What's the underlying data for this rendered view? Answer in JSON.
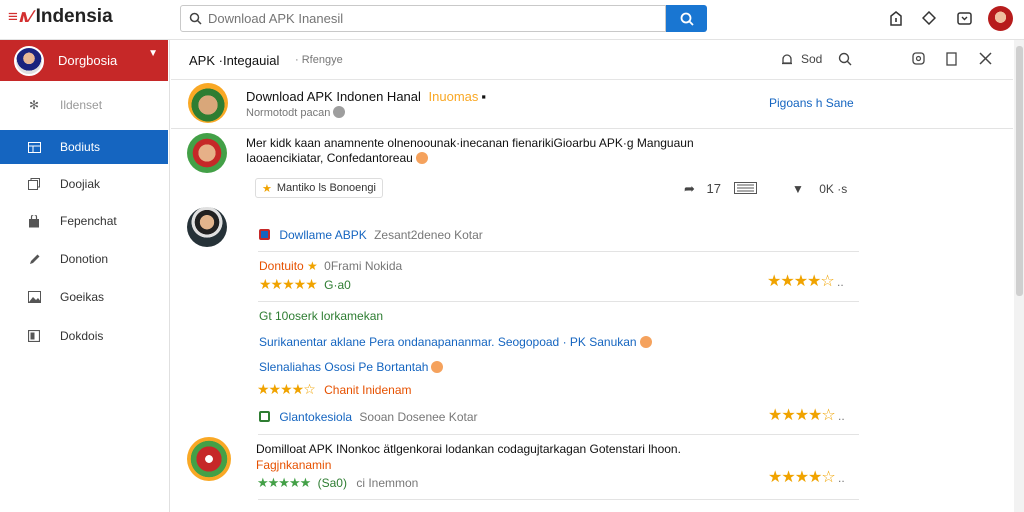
{
  "header": {
    "logo_mark": "≡∧∕",
    "logo_text": "Indensia",
    "search_placeholder": "Download APK Inanesil",
    "icons": [
      "search-icon",
      "info-icon",
      "tag-icon",
      "bookmark-icon",
      "avatar"
    ]
  },
  "sidebar": {
    "user_label": "Dorgbosia",
    "items": [
      {
        "label": "Ildenset",
        "icon": "gear-icon",
        "state": "muted"
      },
      {
        "label": "Bodiuts",
        "icon": "grid-icon",
        "state": "active"
      },
      {
        "label": "Doojiak",
        "icon": "copy-icon",
        "state": "normal"
      },
      {
        "label": "Fepenchat",
        "icon": "bag-icon",
        "state": "normal"
      },
      {
        "label": "Donotion",
        "icon": "pen-icon",
        "state": "normal"
      },
      {
        "label": "Goeikas",
        "icon": "image-icon",
        "state": "normal"
      },
      {
        "label": "Dokdois",
        "icon": "window-icon",
        "state": "normal"
      }
    ]
  },
  "tabbar": {
    "title": "APK ·Integauial",
    "subtitle": "· Rfengye",
    "action_label": "Sod"
  },
  "posts": {
    "p1": {
      "title": "Download APK Indonen Hanal",
      "title_tag": "Inuomas",
      "subtitle": "Normotodt pacan",
      "action": "Pigoans h Sane"
    },
    "p2": {
      "text_line1": "Mer kidk kaan anamnente olnenoounak·inecanan fienarikiGioarbu APK·g Manguaun",
      "text_line2": "Iaoaencikiatar, Confedantoreau",
      "chip": "Mantiko ls Bonoengi",
      "share_count": "17",
      "like_count": "0K ·s"
    },
    "p3": {
      "line1_link": "Dowllame ABPK",
      "line1_rest": "Zesant2deneo Kotar",
      "line2_name": "Dontuito",
      "line2_rest": "0Frami Nokida",
      "line3_score": "G·a0",
      "line4": "Gt 10oserk lorkamekan",
      "line5": "Surikanentar aklane Pera ondanapananmar. Seogopoad · PK Sanukan",
      "line6": "Slenaliahas Ososi Pe Bortantah",
      "line7_rest": "Chanit  Inidenam",
      "line8_link": "Glantokesiola",
      "line8_rest": "Sooan Dosenee Kotar"
    },
    "p4": {
      "text_line1": "Domilloat APK INonkoc ätlgenkorai lodankan codagujtarkagan Gotenstari lhoon.",
      "text_line2": "Fagjnkanamin",
      "score": "(Sa0)",
      "meta": "ci  Inemmon"
    }
  },
  "ratings": {
    "p3_main": 0.8,
    "p3_left": 0.9,
    "p3_line6": 0.8,
    "p3_line8": 0.8,
    "p4_right": 0.8,
    "p4_green": 1.0
  },
  "colors": {
    "accent_blue": "#1565c0",
    "brand_red": "#c62828",
    "star": "#f0a300",
    "green": "#2e7d32"
  }
}
